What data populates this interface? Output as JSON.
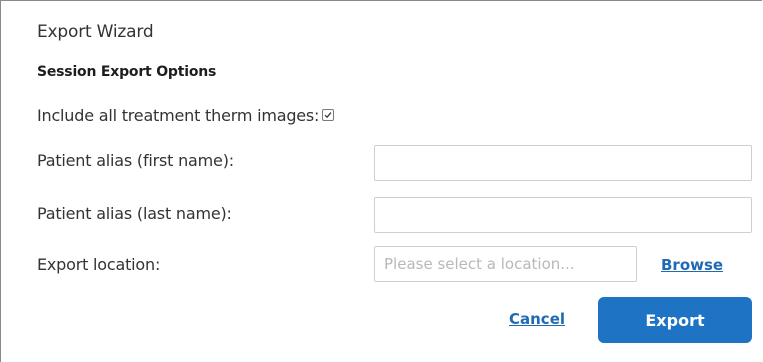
{
  "window": {
    "title": "Export Wizard"
  },
  "section": {
    "title": "Session Export Options"
  },
  "include_images": {
    "label": "Include all treatment therm images:",
    "checked": true
  },
  "first_name": {
    "label": "Patient alias (first name):",
    "value": ""
  },
  "last_name": {
    "label": "Patient alias (last name):",
    "value": ""
  },
  "export_location": {
    "label": "Export location:",
    "value": "",
    "placeholder": "Please select a location...",
    "browse_label": "Browse"
  },
  "actions": {
    "cancel_label": "Cancel",
    "export_label": "Export"
  },
  "colors": {
    "accent": "#1f73c4",
    "link": "#1f6ab3"
  }
}
